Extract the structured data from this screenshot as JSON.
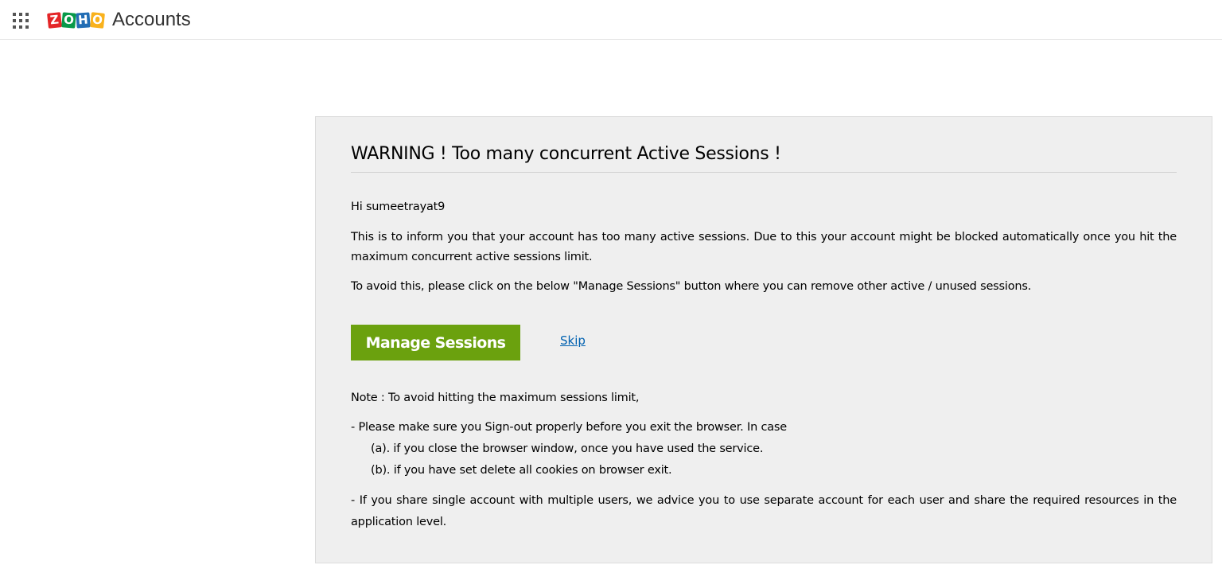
{
  "header": {
    "apps_icon": "grid-icon",
    "logo": {
      "letters": [
        "Z",
        "O",
        "H",
        "O"
      ],
      "colors": [
        "#e42527",
        "#089949",
        "#226db4",
        "#f9b21d"
      ]
    },
    "app_title": "Accounts"
  },
  "warning": {
    "title": "WARNING ! Too many concurrent Active Sessions !",
    "greeting": "Hi sumeetrayat9",
    "message": "This is to inform you that your account has too many active sessions. Due to this your account might be blocked automatically once you hit the maximum concurrent active sessions limit.",
    "instruction": "To avoid this, please click on the below \"Manage Sessions\" button where you can remove other active / unused sessions.",
    "manage_button_label": "Manage Sessions",
    "skip_label": "Skip",
    "note_heading": "Note : To avoid hitting the maximum sessions limit,",
    "note_point_1": "- Please make sure you Sign-out properly before you exit the browser. In case",
    "note_point_1a": "(a). if you close the browser window, once you have used the service.",
    "note_point_1b": "(b). if you have set delete all cookies on browser exit.",
    "note_point_2": "- If you share single account with multiple users, we advice you to use separate account for each user and share the required resources in the application level."
  },
  "colors": {
    "button_green": "#6ba10e",
    "link_blue": "#0061b0",
    "panel_bg": "#efefef"
  }
}
